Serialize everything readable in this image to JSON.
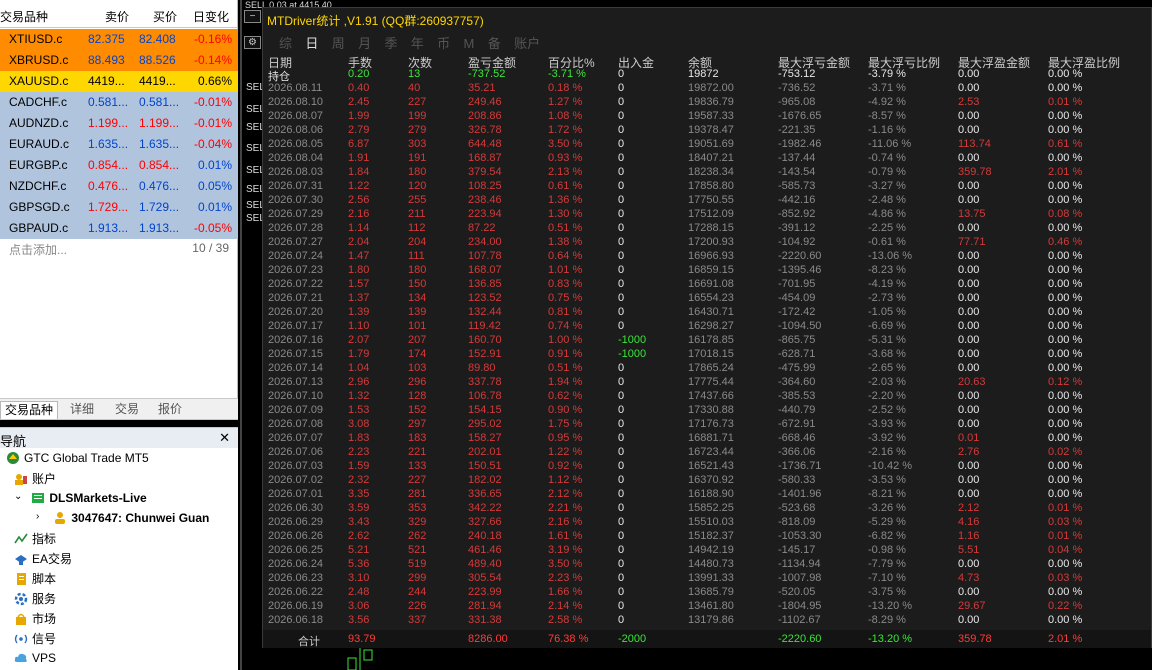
{
  "market_watch": {
    "headers": {
      "symbol": "交易品种",
      "bid": "卖价",
      "ask": "买价",
      "change": "日变化"
    },
    "rows": [
      {
        "symbol": "XTIUSD.c",
        "bid": "82.375",
        "ask": "82.408",
        "change": "-0.16%",
        "bg": "#ff8c00",
        "bidcolor": "#0044cc",
        "askcolor": "#0044cc",
        "chgcolor": "#ff0000"
      },
      {
        "symbol": "XBRUSD.c",
        "bid": "88.493",
        "ask": "88.526",
        "change": "-0.14%",
        "bg": "#ff8c00",
        "bidcolor": "#0044cc",
        "askcolor": "#0044cc",
        "chgcolor": "#ff0000"
      },
      {
        "symbol": "XAUUSD.c",
        "bid": "4419...",
        "ask": "4419...",
        "change": "0.66%",
        "bg": "#ffd700",
        "bidcolor": "#000000",
        "askcolor": "#000000",
        "chgcolor": "#000000"
      },
      {
        "symbol": "CADCHF.c",
        "bid": "0.581...",
        "ask": "0.581...",
        "change": "-0.01%",
        "bg": "#b0c4de",
        "bidcolor": "#0044cc",
        "askcolor": "#0044cc",
        "chgcolor": "#ff0000"
      },
      {
        "symbol": "AUDNZD.c",
        "bid": "1.199...",
        "ask": "1.199...",
        "change": "-0.01%",
        "bg": "#b0c4de",
        "bidcolor": "#ff0000",
        "askcolor": "#ff0000",
        "chgcolor": "#ff0000"
      },
      {
        "symbol": "EURAUD.c",
        "bid": "1.635...",
        "ask": "1.635...",
        "change": "-0.04%",
        "bg": "#b0c4de",
        "bidcolor": "#0044cc",
        "askcolor": "#0044cc",
        "chgcolor": "#ff0000"
      },
      {
        "symbol": "EURGBP.c",
        "bid": "0.854...",
        "ask": "0.854...",
        "change": "0.01%",
        "bg": "#b0c4de",
        "bidcolor": "#ff0000",
        "askcolor": "#ff0000",
        "chgcolor": "#0044cc"
      },
      {
        "symbol": "NZDCHF.c",
        "bid": "0.476...",
        "ask": "0.476...",
        "change": "0.05%",
        "bg": "#b0c4de",
        "bidcolor": "#ff0000",
        "askcolor": "#0044cc",
        "chgcolor": "#0044cc"
      },
      {
        "symbol": "GBPSGD.c",
        "bid": "1.729...",
        "ask": "1.729...",
        "change": "0.01%",
        "bg": "#b0c4de",
        "bidcolor": "#ff0000",
        "askcolor": "#0044cc",
        "chgcolor": "#0044cc"
      },
      {
        "symbol": "GBPAUD.c",
        "bid": "1.913...",
        "ask": "1.913...",
        "change": "-0.05%",
        "bg": "#b0c4de",
        "bidcolor": "#0044cc",
        "askcolor": "#0044cc",
        "chgcolor": "#ff0000"
      }
    ],
    "add_text": "点击添加...",
    "count": "10 / 39",
    "tabs": [
      "交易品种",
      "详细",
      "交易",
      "报价"
    ]
  },
  "navigator": {
    "title": "导航",
    "items": [
      {
        "label": "GTC Global Trade MT5",
        "icon": "platform-icon"
      },
      {
        "label": "账户",
        "icon": "accounts-icon"
      },
      {
        "label": "DLSMarkets-Live",
        "icon": "server-icon"
      },
      {
        "label": "3047647: Chunwei Guan",
        "icon": "user-icon"
      },
      {
        "label": "指标",
        "icon": "indicators-icon"
      },
      {
        "label": "EA交易",
        "icon": "expert-advisor-icon"
      },
      {
        "label": "脚本",
        "icon": "scripts-icon"
      },
      {
        "label": "服务",
        "icon": "services-icon"
      },
      {
        "label": "市场",
        "icon": "market-icon"
      },
      {
        "label": "信号",
        "icon": "signals-icon"
      },
      {
        "label": "VPS",
        "icon": "vps-icon"
      }
    ]
  },
  "panel": {
    "title": "MTDriver统计 ,V1.91 (QQ群:260937757)",
    "tabs": [
      "综",
      "日",
      "周",
      "月",
      "季",
      "年",
      "币",
      "M",
      "备",
      "账户"
    ],
    "active_tab": "日",
    "headers": [
      "日期",
      "手数",
      "次数",
      "盈亏金额",
      "百分比%",
      "出入金",
      "余额",
      "最大浮亏金额",
      "最大浮亏比例",
      "最大浮盈金额",
      "最大浮盈比例"
    ],
    "rows": [
      [
        "持仓",
        "0.20",
        "13",
        "-737.52",
        "-3.71 %",
        "0",
        "19872",
        "-753.12",
        "-3.79 %",
        "0.00",
        "0.00 %"
      ],
      [
        "2026.08.11",
        "0.40",
        "40",
        "35.21",
        "0.18 %",
        "0",
        "19872.00",
        "-736.52",
        "-3.71 %",
        "0.00",
        "0.00 %"
      ],
      [
        "2026.08.10",
        "2.45",
        "227",
        "249.46",
        "1.27 %",
        "0",
        "19836.79",
        "-965.08",
        "-4.92 %",
        "2.53",
        "0.01 %"
      ],
      [
        "2026.08.07",
        "1.99",
        "199",
        "208.86",
        "1.08 %",
        "0",
        "19587.33",
        "-1676.65",
        "-8.57 %",
        "0.00",
        "0.00 %"
      ],
      [
        "2026.08.06",
        "2.79",
        "279",
        "326.78",
        "1.72 %",
        "0",
        "19378.47",
        "-221.35",
        "-1.16 %",
        "0.00",
        "0.00 %"
      ],
      [
        "2026.08.05",
        "6.87",
        "303",
        "644.48",
        "3.50 %",
        "0",
        "19051.69",
        "-1982.46",
        "-11.06 %",
        "113.74",
        "0.61 %"
      ],
      [
        "2026.08.04",
        "1.91",
        "191",
        "168.87",
        "0.93 %",
        "0",
        "18407.21",
        "-137.44",
        "-0.74 %",
        "0.00",
        "0.00 %"
      ],
      [
        "2026.08.03",
        "1.84",
        "180",
        "379.54",
        "2.13 %",
        "0",
        "18238.34",
        "-143.54",
        "-0.79 %",
        "359.78",
        "2.01 %"
      ],
      [
        "2026.07.31",
        "1.22",
        "120",
        "108.25",
        "0.61 %",
        "0",
        "17858.80",
        "-585.73",
        "-3.27 %",
        "0.00",
        "0.00 %"
      ],
      [
        "2026.07.30",
        "2.56",
        "255",
        "238.46",
        "1.36 %",
        "0",
        "17750.55",
        "-442.16",
        "-2.48 %",
        "0.00",
        "0.00 %"
      ],
      [
        "2026.07.29",
        "2.16",
        "211",
        "223.94",
        "1.30 %",
        "0",
        "17512.09",
        "-852.92",
        "-4.86 %",
        "13.75",
        "0.08 %"
      ],
      [
        "2026.07.28",
        "1.14",
        "112",
        "87.22",
        "0.51 %",
        "0",
        "17288.15",
        "-391.12",
        "-2.25 %",
        "0.00",
        "0.00 %"
      ],
      [
        "2026.07.27",
        "2.04",
        "204",
        "234.00",
        "1.38 %",
        "0",
        "17200.93",
        "-104.92",
        "-0.61 %",
        "77.71",
        "0.46 %"
      ],
      [
        "2026.07.24",
        "1.47",
        "111",
        "107.78",
        "0.64 %",
        "0",
        "16966.93",
        "-2220.60",
        "-13.06 %",
        "0.00",
        "0.00 %"
      ],
      [
        "2026.07.23",
        "1.80",
        "180",
        "168.07",
        "1.01 %",
        "0",
        "16859.15",
        "-1395.46",
        "-8.23 %",
        "0.00",
        "0.00 %"
      ],
      [
        "2026.07.22",
        "1.57",
        "150",
        "136.85",
        "0.83 %",
        "0",
        "16691.08",
        "-701.95",
        "-4.19 %",
        "0.00",
        "0.00 %"
      ],
      [
        "2026.07.21",
        "1.37",
        "134",
        "123.52",
        "0.75 %",
        "0",
        "16554.23",
        "-454.09",
        "-2.73 %",
        "0.00",
        "0.00 %"
      ],
      [
        "2026.07.20",
        "1.39",
        "139",
        "132.44",
        "0.81 %",
        "0",
        "16430.71",
        "-172.42",
        "-1.05 %",
        "0.00",
        "0.00 %"
      ],
      [
        "2026.07.17",
        "1.10",
        "101",
        "119.42",
        "0.74 %",
        "0",
        "16298.27",
        "-1094.50",
        "-6.69 %",
        "0.00",
        "0.00 %"
      ],
      [
        "2026.07.16",
        "2.07",
        "207",
        "160.70",
        "1.00 %",
        "-1000",
        "16178.85",
        "-865.75",
        "-5.31 %",
        "0.00",
        "0.00 %"
      ],
      [
        "2026.07.15",
        "1.79",
        "174",
        "152.91",
        "0.91 %",
        "-1000",
        "17018.15",
        "-628.71",
        "-3.68 %",
        "0.00",
        "0.00 %"
      ],
      [
        "2026.07.14",
        "1.04",
        "103",
        "89.80",
        "0.51 %",
        "0",
        "17865.24",
        "-475.99",
        "-2.65 %",
        "0.00",
        "0.00 %"
      ],
      [
        "2026.07.13",
        "2.96",
        "296",
        "337.78",
        "1.94 %",
        "0",
        "17775.44",
        "-364.60",
        "-2.03 %",
        "20.63",
        "0.12 %"
      ],
      [
        "2026.07.10",
        "1.32",
        "128",
        "106.78",
        "0.62 %",
        "0",
        "17437.66",
        "-385.53",
        "-2.20 %",
        "0.00",
        "0.00 %"
      ],
      [
        "2026.07.09",
        "1.53",
        "152",
        "154.15",
        "0.90 %",
        "0",
        "17330.88",
        "-440.79",
        "-2.52 %",
        "0.00",
        "0.00 %"
      ],
      [
        "2026.07.08",
        "3.08",
        "297",
        "295.02",
        "1.75 %",
        "0",
        "17176.73",
        "-672.91",
        "-3.93 %",
        "0.00",
        "0.00 %"
      ],
      [
        "2026.07.07",
        "1.83",
        "183",
        "158.27",
        "0.95 %",
        "0",
        "16881.71",
        "-668.46",
        "-3.92 %",
        "0.01",
        "0.00 %"
      ],
      [
        "2026.07.06",
        "2.23",
        "221",
        "202.01",
        "1.22 %",
        "0",
        "16723.44",
        "-366.06",
        "-2.16 %",
        "2.76",
        "0.02 %"
      ],
      [
        "2026.07.03",
        "1.59",
        "133",
        "150.51",
        "0.92 %",
        "0",
        "16521.43",
        "-1736.71",
        "-10.42 %",
        "0.00",
        "0.00 %"
      ],
      [
        "2026.07.02",
        "2.32",
        "227",
        "182.02",
        "1.12 %",
        "0",
        "16370.92",
        "-580.33",
        "-3.53 %",
        "0.00",
        "0.00 %"
      ],
      [
        "2026.07.01",
        "3.35",
        "281",
        "336.65",
        "2.12 %",
        "0",
        "16188.90",
        "-1401.96",
        "-8.21 %",
        "0.00",
        "0.00 %"
      ],
      [
        "2026.06.30",
        "3.59",
        "353",
        "342.22",
        "2.21 %",
        "0",
        "15852.25",
        "-523.68",
        "-3.26 %",
        "2.12",
        "0.01 %"
      ],
      [
        "2026.06.29",
        "3.43",
        "329",
        "327.66",
        "2.16 %",
        "0",
        "15510.03",
        "-818.09",
        "-5.29 %",
        "4.16",
        "0.03 %"
      ],
      [
        "2026.06.26",
        "2.62",
        "262",
        "240.18",
        "1.61 %",
        "0",
        "15182.37",
        "-1053.30",
        "-6.82 %",
        "1.16",
        "0.01 %"
      ],
      [
        "2026.06.25",
        "5.21",
        "521",
        "461.46",
        "3.19 %",
        "0",
        "14942.19",
        "-145.17",
        "-0.98 %",
        "5.51",
        "0.04 %"
      ],
      [
        "2026.06.24",
        "5.36",
        "519",
        "489.40",
        "3.50 %",
        "0",
        "14480.73",
        "-1134.94",
        "-7.79 %",
        "0.00",
        "0.00 %"
      ],
      [
        "2026.06.23",
        "3.10",
        "299",
        "305.54",
        "2.23 %",
        "0",
        "13991.33",
        "-1007.98",
        "-7.10 %",
        "4.73",
        "0.03 %"
      ],
      [
        "2026.06.22",
        "2.48",
        "244",
        "223.99",
        "1.66 %",
        "0",
        "13685.79",
        "-520.05",
        "-3.75 %",
        "0.00",
        "0.00 %"
      ],
      [
        "2026.06.19",
        "3.06",
        "226",
        "281.94",
        "2.14 %",
        "0",
        "13461.80",
        "-1804.95",
        "-13.20 %",
        "29.67",
        "0.22 %"
      ],
      [
        "2026.06.18",
        "3.56",
        "337",
        "331.38",
        "2.58 %",
        "0",
        "13179.86",
        "-1102.67",
        "-8.29 %",
        "0.00",
        "0.00 %"
      ]
    ],
    "totals": [
      "合计",
      "93.79",
      "8286.00",
      "76.38 %",
      "-2000",
      "-2220.60",
      "-13.20 %",
      "359.78",
      "2.01 %"
    ]
  },
  "chart": {
    "sell_label": "SELL",
    "sell_visible_texts": [
      "SELL 0.03 at 4415.40",
      "SEL",
      "SEL",
      "SEL",
      "SEL",
      "SEL",
      "SEL",
      "SEL",
      "SEL"
    ]
  },
  "colors": {
    "panel_bg": "#1c1c1c",
    "title_yellow": "#ffd700",
    "positive": "#39e639",
    "negative": "#ff3b3b",
    "neutral": "#8a8a8a"
  }
}
